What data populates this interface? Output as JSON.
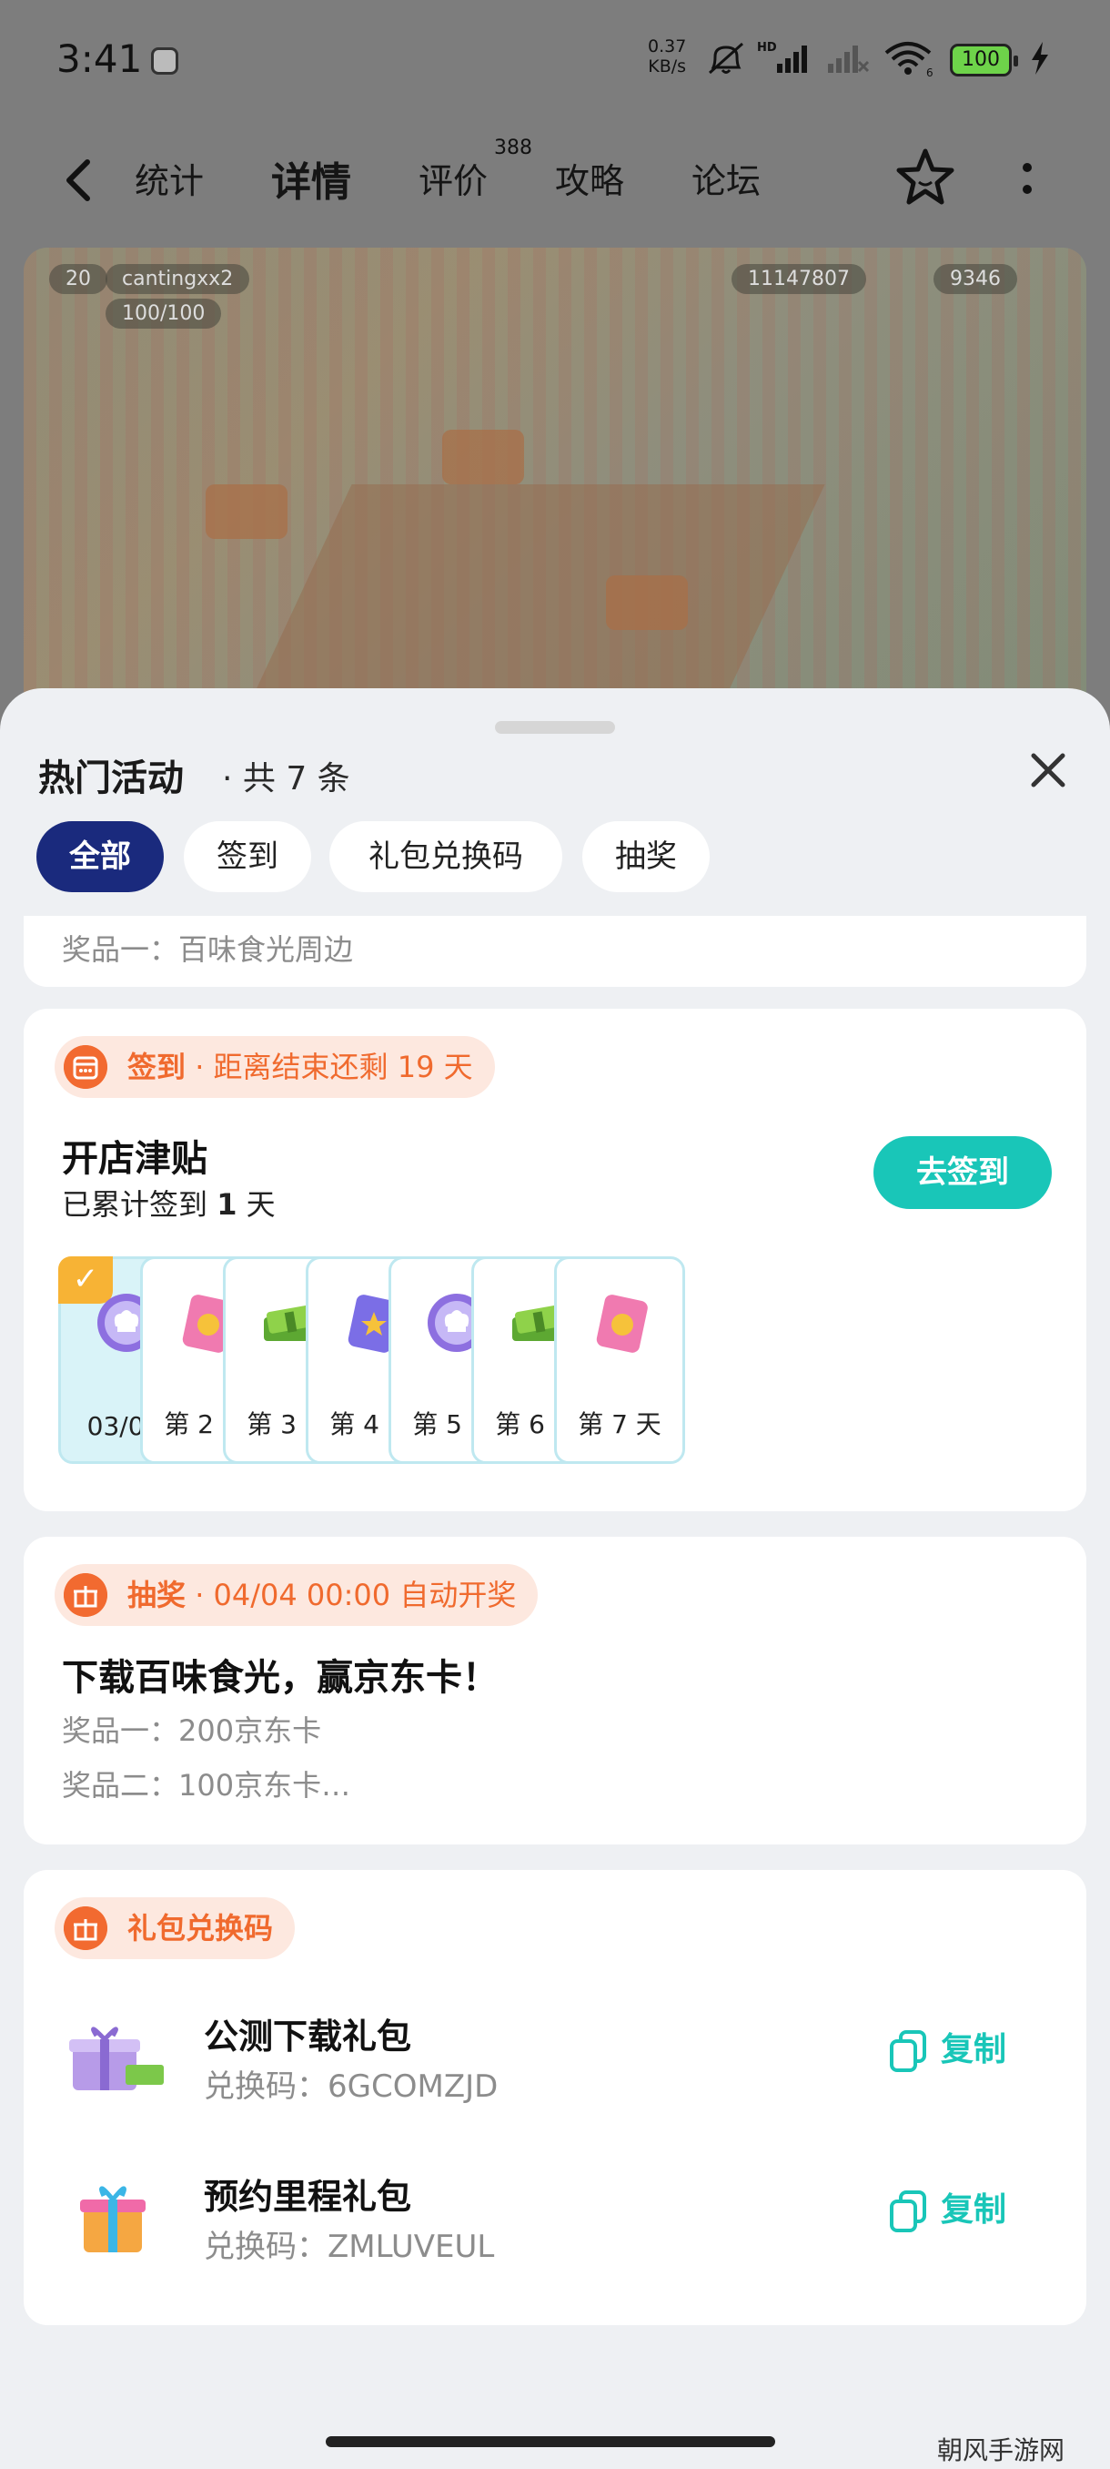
{
  "status_bar": {
    "time": "3:41",
    "net_speed_value": "0.37",
    "net_speed_unit": "KB/s",
    "signal_label": "HD",
    "wifi_label": "6",
    "battery": "100"
  },
  "nav": {
    "tabs": [
      {
        "label": "统计"
      },
      {
        "label": "详情"
      },
      {
        "label": "评价"
      },
      {
        "label": "攻略"
      },
      {
        "label": "论坛"
      }
    ],
    "review_badge": "388",
    "active_tab": "详情"
  },
  "game_shot": {
    "player_name": "cantingxx2",
    "player_level": "20",
    "energy": "100/100",
    "coins": "11147807",
    "cash": "9346"
  },
  "sheet": {
    "title": "热门活动",
    "count": "· 共 7 条",
    "filters": [
      {
        "label": "全部"
      },
      {
        "label": "签到"
      },
      {
        "label": "礼包兑换码"
      },
      {
        "label": "抽奖"
      }
    ],
    "previous_card_line": "奖品一：百味食光周边",
    "checkin": {
      "tag": "签到",
      "countdown": "·  距离结束还剩 19 天",
      "title": "开店津贴",
      "progress_prefix": "已累计签到",
      "progress_days": "1",
      "progress_suffix": "天",
      "button": "去签到",
      "days": [
        {
          "label": "03/06",
          "reward_icon": "chef-coin-icon",
          "done": true
        },
        {
          "label": "第 2 天",
          "reward_icon": "ticket-icon",
          "done": false
        },
        {
          "label": "第 3 天",
          "reward_icon": "cash-stack-icon",
          "done": false
        },
        {
          "label": "第 4 天",
          "reward_icon": "star-ticket-icon",
          "done": false
        },
        {
          "label": "第 5 天",
          "reward_icon": "chef-coin-icon",
          "done": false
        },
        {
          "label": "第 6 天",
          "reward_icon": "cash-stack-icon",
          "done": false
        },
        {
          "label": "第 7 天",
          "reward_icon": "ticket-icon",
          "done": false
        }
      ],
      "check_mark": "✓"
    },
    "lottery": {
      "tag": "抽奖",
      "time": "·  04/04 00:00 自动开奖",
      "title": "下载百味食光，赢京东卡！",
      "prizes": [
        "奖品一：200京东卡",
        "奖品二：100京东卡…"
      ]
    },
    "gift_codes": {
      "tag": "礼包兑换码",
      "items": [
        {
          "name": "公测下载礼包",
          "code": "兑换码：6GCOMZJD",
          "copy": "复制"
        },
        {
          "name": "预约里程礼包",
          "code": "兑换码：ZMLUVEUL",
          "copy": "复制"
        }
      ]
    }
  },
  "watermark": "朝风手游网",
  "colors": {
    "accent": "#19c6b8",
    "filter_active": "#1a2a7d",
    "tag_orange": "#f06a2e",
    "tag_bg": "#fde8df"
  }
}
